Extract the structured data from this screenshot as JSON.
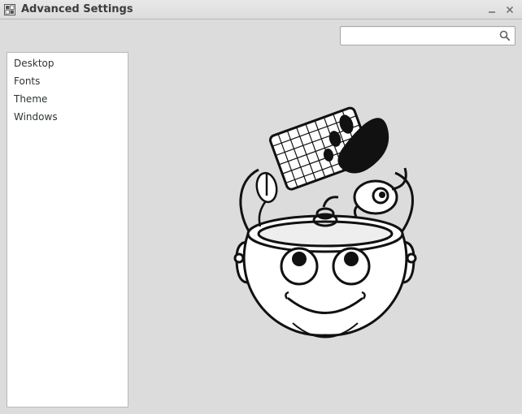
{
  "window": {
    "title": "Advanced Settings"
  },
  "search": {
    "value": "",
    "placeholder": ""
  },
  "sidebar": {
    "items": [
      {
        "label": "Desktop"
      },
      {
        "label": "Fonts"
      },
      {
        "label": "Theme"
      },
      {
        "label": "Windows"
      }
    ]
  }
}
